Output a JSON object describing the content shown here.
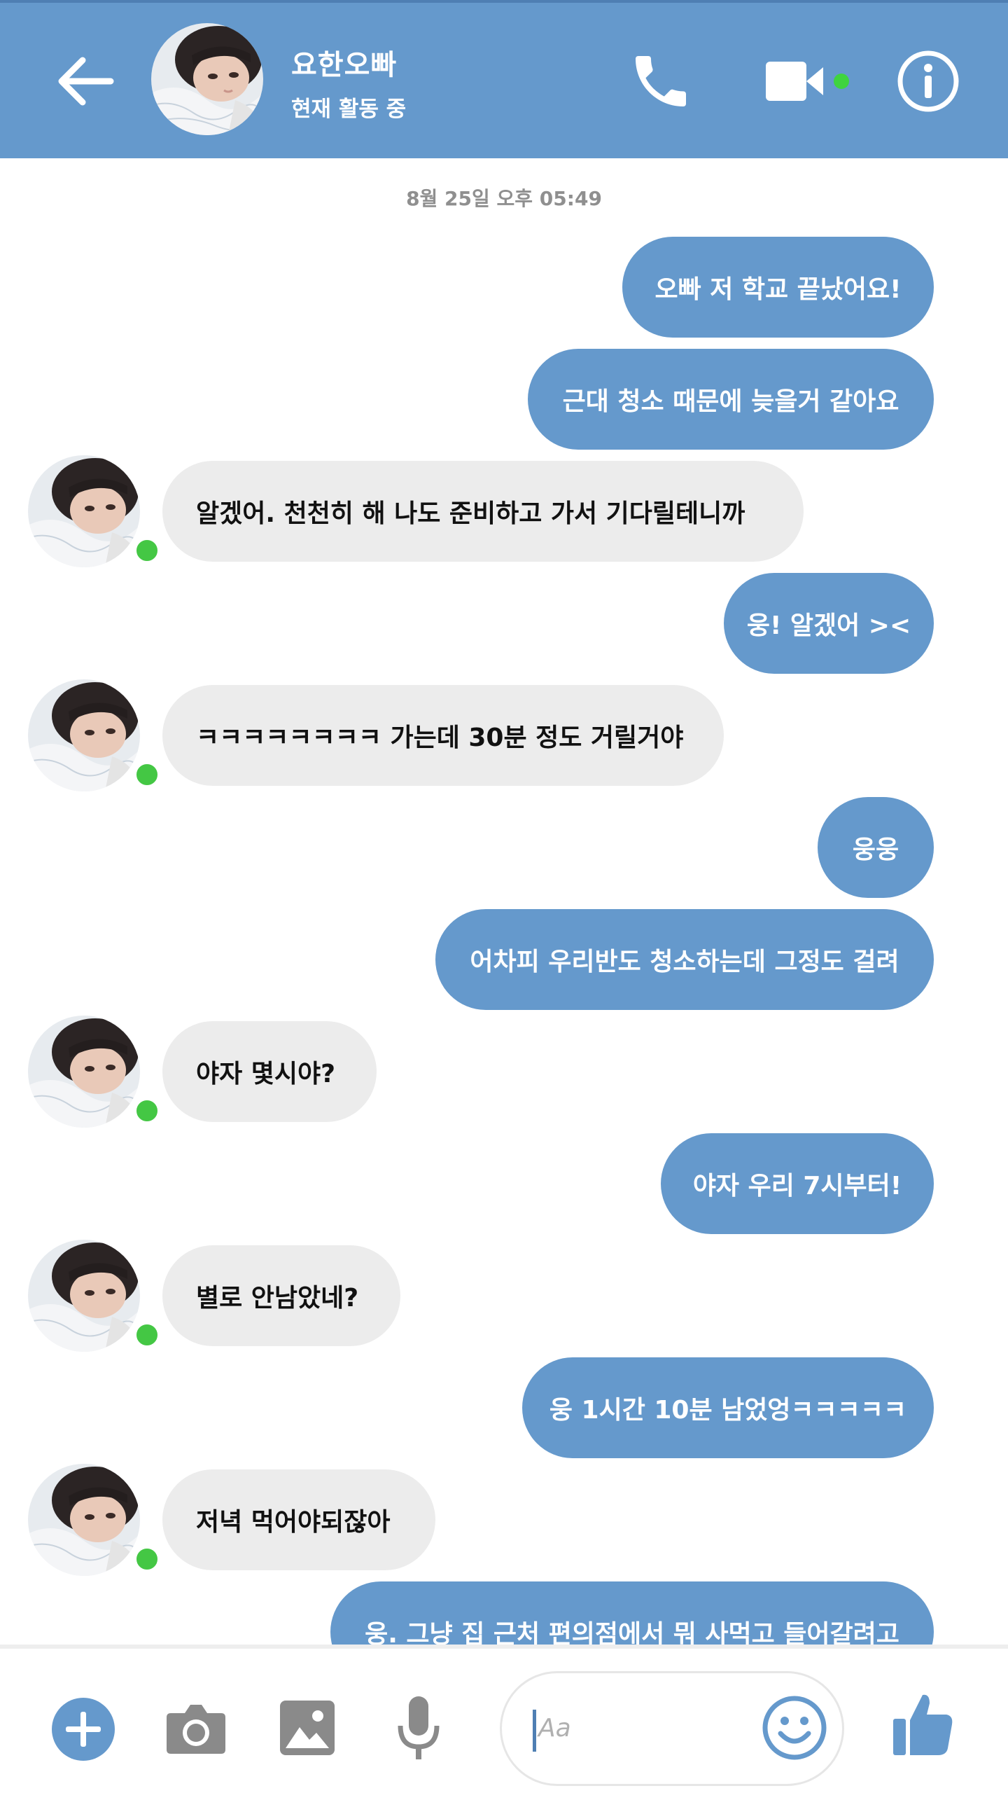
{
  "header": {
    "contact_name": "요한오빠",
    "status": "현재 활동 중",
    "online_dot_color": "#3fd43f",
    "bar_color": "#6599cc"
  },
  "conversation": {
    "date_separator": "8월 25일 오후 05:49",
    "messages": [
      {
        "sender": "me",
        "text": "오빠 저 학교 끝났어요!"
      },
      {
        "sender": "me",
        "text": "근대 청소 때문에 늦을거 같아요"
      },
      {
        "sender": "them",
        "text": "알겠어. 천천히 해 나도 준비하고 가서 기다릴테니까"
      },
      {
        "sender": "me",
        "text": "웅! 알겠어 ><"
      },
      {
        "sender": "them",
        "text": "ㅋㅋㅋㅋㅋㅋㅋㅋ 가는데 30분 정도 거릴거야"
      },
      {
        "sender": "me",
        "text": "웅웅"
      },
      {
        "sender": "me",
        "text": "어차피 우리반도 청소하는데 그정도 걸려"
      },
      {
        "sender": "them",
        "text": "야자 몇시야?"
      },
      {
        "sender": "me",
        "text": "야자 우리 7시부터!"
      },
      {
        "sender": "them",
        "text": "별로 안남았네?"
      },
      {
        "sender": "me",
        "text": "웅 1시간 10분 남었엉ㅋㅋㅋㅋㅋ"
      },
      {
        "sender": "them",
        "text": "저녁 먹어야되잖아"
      },
      {
        "sender": "me",
        "text": "웅. 그냥 집 근처 편의점에서 뭐 사먹고 들어갈려고"
      }
    ]
  },
  "composer": {
    "placeholder": "Aa",
    "icons": [
      "plus-icon",
      "camera-icon",
      "image-icon",
      "microphone-icon",
      "smiley-icon",
      "thumbs-up-icon"
    ],
    "accent_color": "#6599cc"
  }
}
